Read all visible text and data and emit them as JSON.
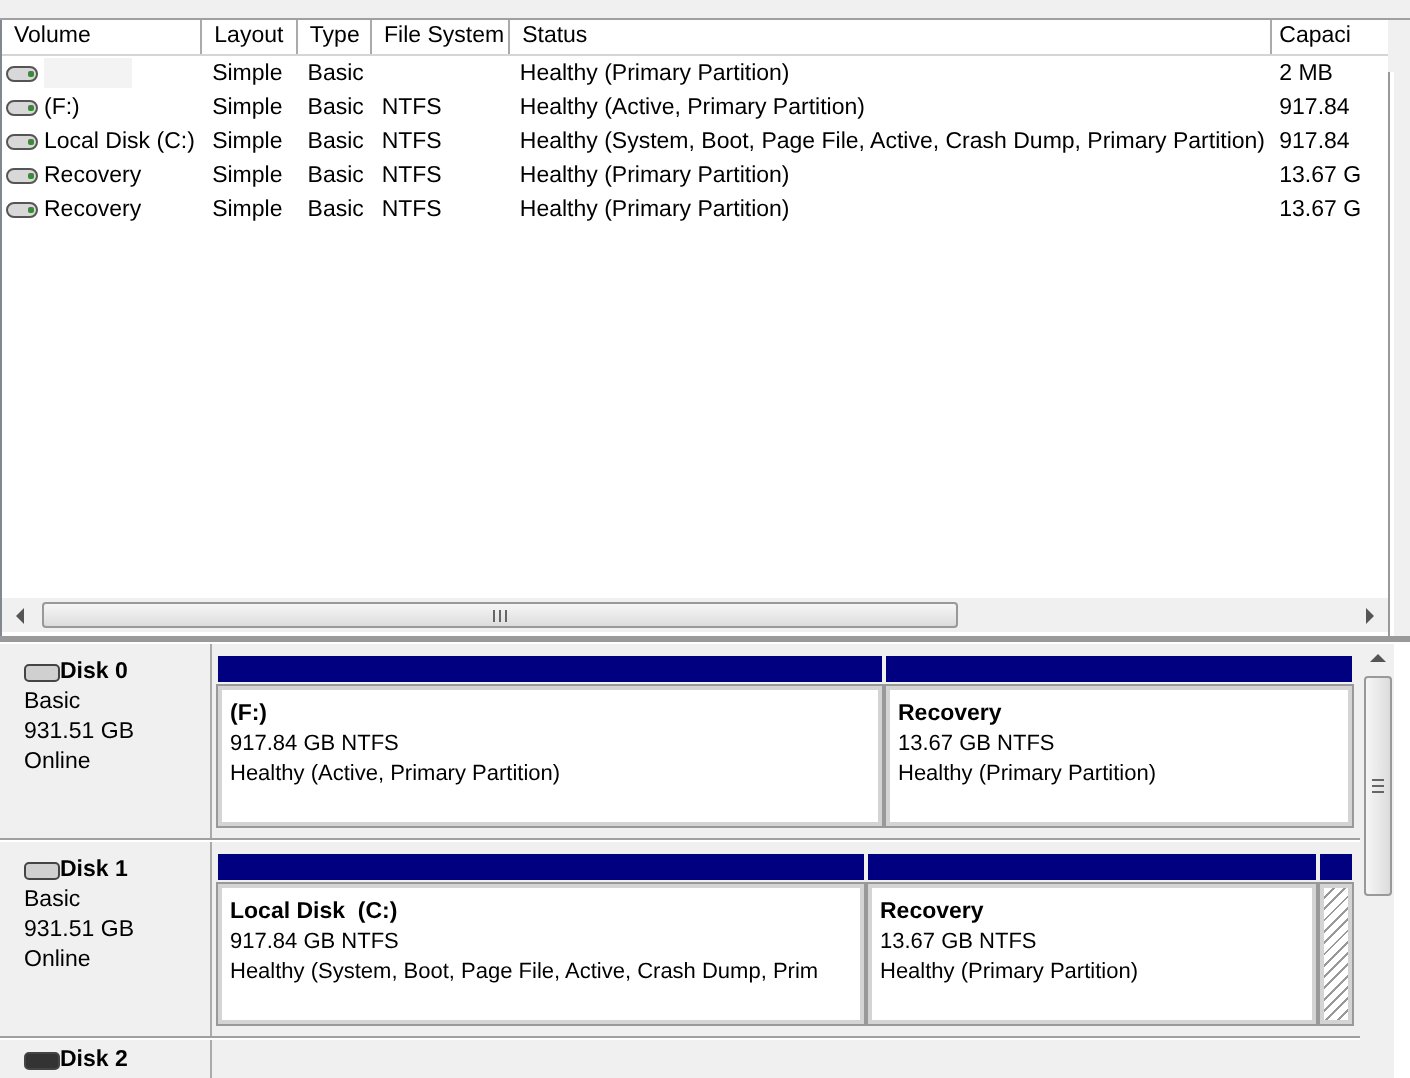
{
  "volume_list": {
    "columns": [
      "Volume",
      "Layout",
      "Type",
      "File System",
      "Status",
      "Capaci"
    ],
    "rows": [
      {
        "volume": "",
        "layout": "Simple",
        "type": "Basic",
        "file_system": "",
        "status": "Healthy (Primary Partition)",
        "capacity": "2 MB"
      },
      {
        "volume": "(F:)",
        "layout": "Simple",
        "type": "Basic",
        "file_system": "NTFS",
        "status": "Healthy (Active, Primary Partition)",
        "capacity": "917.84"
      },
      {
        "volume": "Local Disk (C:)",
        "layout": "Simple",
        "type": "Basic",
        "file_system": "NTFS",
        "status": "Healthy (System, Boot, Page File, Active, Crash Dump, Primary Partition)",
        "capacity": "917.84"
      },
      {
        "volume": "Recovery",
        "layout": "Simple",
        "type": "Basic",
        "file_system": "NTFS",
        "status": "Healthy (Primary Partition)",
        "capacity": "13.67 G"
      },
      {
        "volume": "Recovery",
        "layout": "Simple",
        "type": "Basic",
        "file_system": "NTFS",
        "status": "Healthy (Primary Partition)",
        "capacity": "13.67 G"
      }
    ]
  },
  "disks": [
    {
      "name": "Disk 0",
      "type": "Basic",
      "size": "931.51 GB",
      "state": "Online",
      "partitions": [
        {
          "kind": "volume",
          "name": "(F:)",
          "size": "917.84 GB NTFS",
          "status": "Healthy (Active, Primary Partition)"
        },
        {
          "kind": "volume",
          "name": "Recovery",
          "size": "13.67 GB NTFS",
          "status": "Healthy (Primary Partition)"
        }
      ]
    },
    {
      "name": "Disk 1",
      "type": "Basic",
      "size": "931.51 GB",
      "state": "Online",
      "partitions": [
        {
          "kind": "volume",
          "name": "Local Disk  (C:)",
          "size": "917.84 GB NTFS",
          "status": "Healthy (System, Boot, Page File, Active, Crash Dump, Prim"
        },
        {
          "kind": "volume",
          "name": "Recovery",
          "size": "13.67 GB NTFS",
          "status": "Healthy (Primary Partition)"
        },
        {
          "kind": "hatched"
        }
      ]
    },
    {
      "name": "Disk 2"
    }
  ]
}
